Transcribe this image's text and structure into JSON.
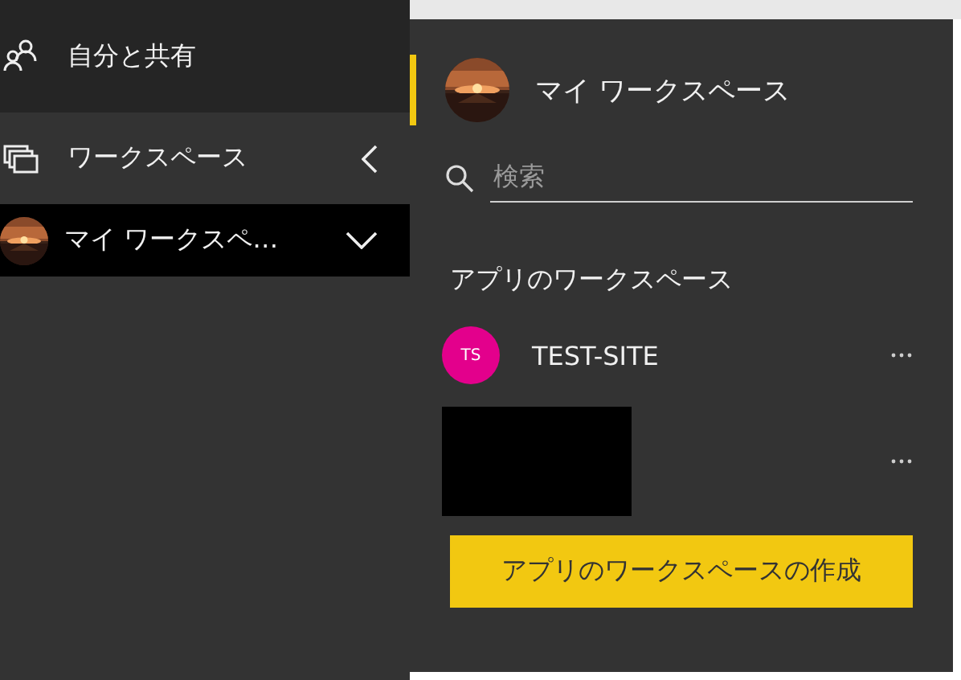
{
  "nav": {
    "items": [
      {
        "kind": "shared",
        "label": "自分と共有",
        "selected": false
      },
      {
        "kind": "workspaces",
        "label": "ワークスペース",
        "selected": false,
        "expanded": true
      },
      {
        "kind": "workspace",
        "label": "マイ ワークスペ…",
        "selected": true
      }
    ]
  },
  "flyout": {
    "current": {
      "label": "マイ ワークスペース",
      "selected": true
    },
    "search": {
      "placeholder": "検索"
    },
    "section_title": "アプリのワークスペース",
    "workspaces": [
      {
        "kind": "initials",
        "initials": "TS",
        "name": "TEST-SITE",
        "color": "#e3008c"
      },
      {
        "kind": "redacted"
      }
    ],
    "create_button": "アプリのワークスペースの作成"
  }
}
